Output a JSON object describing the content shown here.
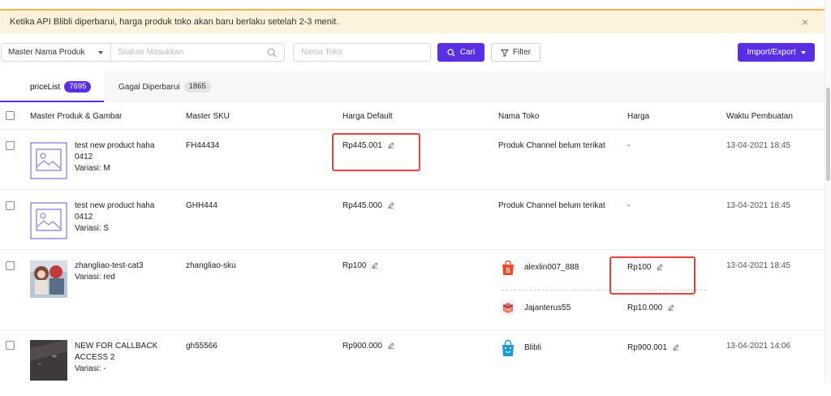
{
  "banner": {
    "text": "Ketika API Blibli diperbarui, harga produk toko akan baru berlaku setelah 2-3 menit.",
    "close": "×"
  },
  "toolbar": {
    "select_value": "Master Nama Produk",
    "search_placeholder": "Silakan Masukkan",
    "toko_placeholder": "Nama Toko",
    "cari_label": "Cari",
    "filter_label": "Filter",
    "import_label": "Import/Export"
  },
  "tabs": [
    {
      "label": "priceList",
      "count": "7695",
      "active": true
    },
    {
      "label": "Gagal Diperbarui",
      "count": "1865",
      "active": false
    }
  ],
  "headers": {
    "produk": "Master Produk & Gambar",
    "sku": "Master SKU",
    "harga_default": "Harga Default",
    "nama_toko": "Nama Toko",
    "harga": "Harga",
    "waktu": "Waktu Pembuatan"
  },
  "rows": [
    {
      "name_l1": "test new product haha",
      "name_l2": "0412",
      "variant": "Variasi: M",
      "sku": "FH44434",
      "price_default": "Rp445.001",
      "stores": [
        {
          "name": "Produk Channel belum terikat",
          "price": "-"
        }
      ],
      "date": "13-04-2021 18:45"
    },
    {
      "name_l1": "test new product haha",
      "name_l2": "0412",
      "variant": "Variasi: S",
      "sku": "GHH444",
      "price_default": "Rp445.000",
      "stores": [
        {
          "name": "Produk Channel belum terikat",
          "price": "-"
        }
      ],
      "date": "13-04-2021 18:45"
    },
    {
      "name_l1": "zhangliao-test-cat3",
      "name_l2": "",
      "variant": "Variasi: red",
      "sku": "zhangliao-sku",
      "price_default": "Rp100",
      "stores": [
        {
          "name": "alexlin007_888",
          "price": "Rp100",
          "icon": "shopee-icon"
        },
        {
          "name": "Jajanterus55",
          "price": "Rp10.000",
          "icon": "lazada-icon"
        }
      ],
      "date": "13-04-2021 18:45"
    },
    {
      "name_l1": "NEW FOR CALLBACK",
      "name_l2": "ACCESS 2",
      "variant": "Variasi: -",
      "sku": "gh55566",
      "price_default": "Rp900.000",
      "stores": [
        {
          "name": "Blibli",
          "price": "Rp900.001",
          "icon": "blibli-icon"
        }
      ],
      "date": "13-04-2021 14:06"
    }
  ],
  "colors": {
    "accent": "#5a2ee5",
    "highlight": "#e0443a",
    "banner_bg": "#fdf3dc"
  }
}
